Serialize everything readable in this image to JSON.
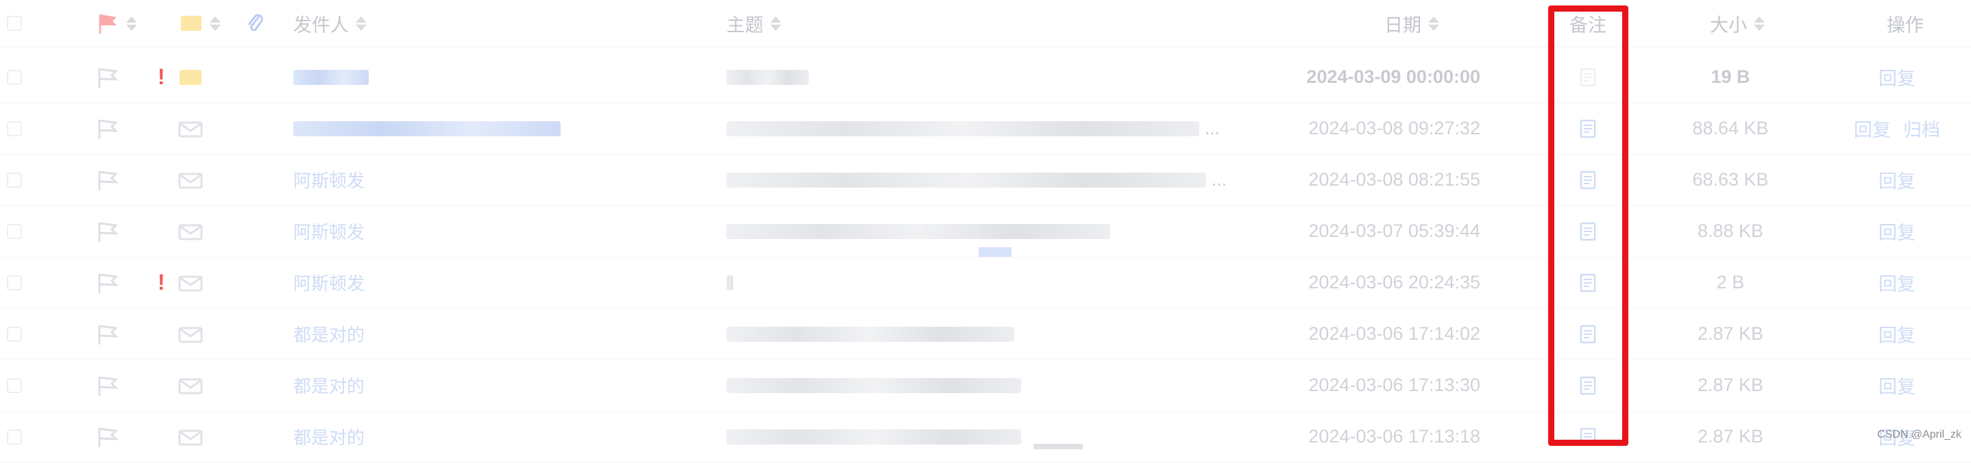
{
  "header": {
    "sender": "发件人",
    "subject": "主题",
    "date": "日期",
    "note": "备注",
    "size": "大小",
    "ops": "操作"
  },
  "icons": {
    "flag_header": "red-flag-icon",
    "folder_header": "yellow-folder-icon",
    "attachment_header": "paperclip-icon",
    "row_flag": "flag-outline-icon",
    "row_envelope": "envelope-icon",
    "row_note": "note-document-icon"
  },
  "colors": {
    "accent": "#cfdcf5",
    "warning": "#f25a5a",
    "highlight": "#e8141b",
    "folder": "#fde7a6"
  },
  "rows": [
    {
      "important": true,
      "envelope": "folder",
      "sender": "",
      "subject": "",
      "date": "2024-03-09 00:00:00",
      "size": "19 B",
      "ops": [
        "回复"
      ],
      "bold": true
    },
    {
      "important": false,
      "envelope": "envelope",
      "sender": "",
      "subject": "",
      "date": "2024-03-08 09:27:32",
      "size": "88.64 KB",
      "ops": [
        "回复",
        "归档"
      ],
      "bold": false
    },
    {
      "important": false,
      "envelope": "envelope",
      "sender": "阿斯顿发",
      "subject": "",
      "date": "2024-03-08 08:21:55",
      "size": "68.63 KB",
      "ops": [
        "回复"
      ],
      "bold": false
    },
    {
      "important": false,
      "envelope": "envelope",
      "sender": "阿斯顿发",
      "subject": "",
      "date": "2024-03-07 05:39:44",
      "size": "8.88 KB",
      "ops": [
        "回复"
      ],
      "bold": false
    },
    {
      "important": true,
      "envelope": "envelope",
      "sender": "阿斯顿发",
      "subject": "",
      "date": "2024-03-06 20:24:35",
      "size": "2 B",
      "ops": [
        "回复"
      ],
      "bold": false
    },
    {
      "important": false,
      "envelope": "envelope",
      "sender": "都是对的",
      "subject": "",
      "date": "2024-03-06 17:14:02",
      "size": "2.87 KB",
      "ops": [
        "回复"
      ],
      "bold": false
    },
    {
      "important": false,
      "envelope": "envelope",
      "sender": "都是对的",
      "subject": "",
      "date": "2024-03-06 17:13:30",
      "size": "2.87 KB",
      "ops": [
        "回复"
      ],
      "bold": false
    },
    {
      "important": false,
      "envelope": "envelope",
      "sender": "都是对的",
      "subject": "",
      "date": "2024-03-06 17:13:18",
      "size": "2.87 KB",
      "ops": [
        "回复"
      ],
      "bold": false
    }
  ],
  "ellipsis": "...",
  "watermark": "CSDN @April_zk"
}
